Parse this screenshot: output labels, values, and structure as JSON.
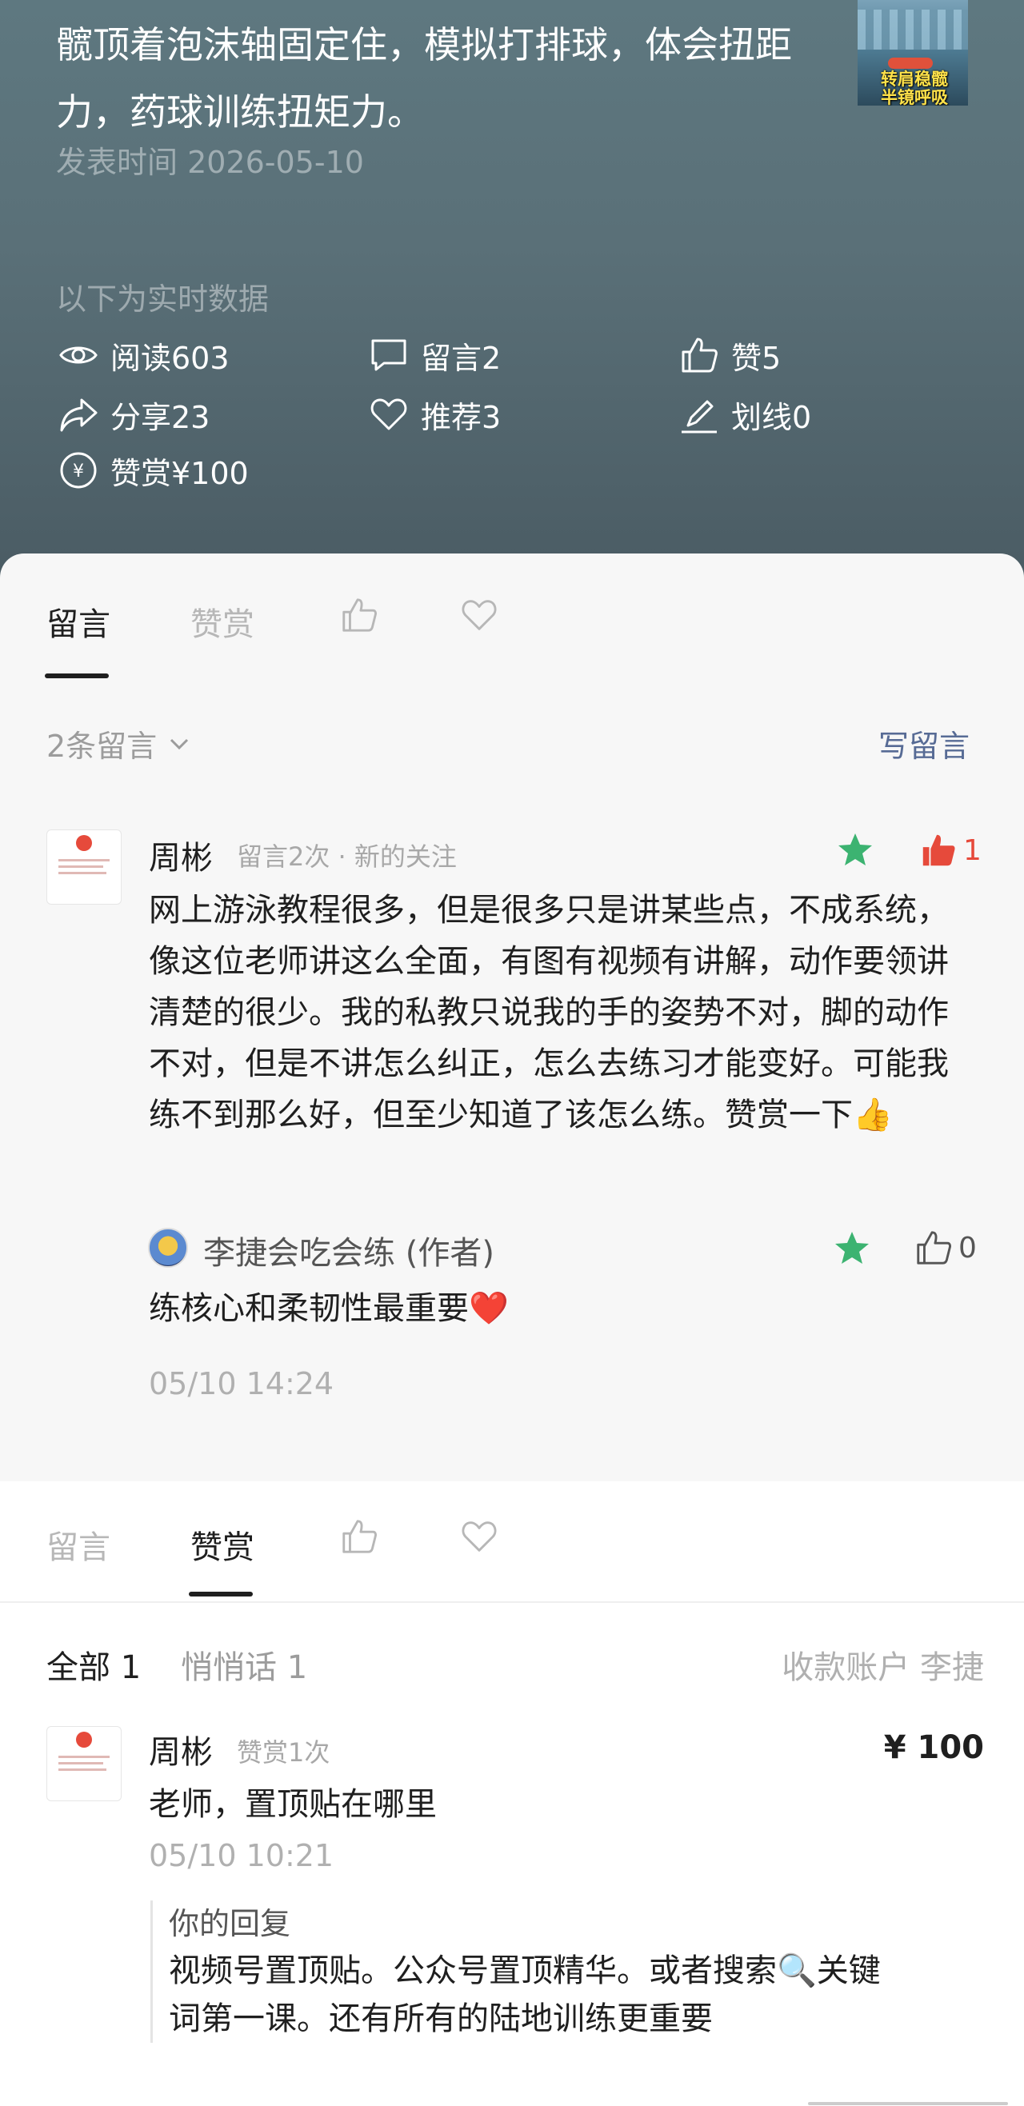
{
  "header": {
    "article_snippet": "髋顶着泡沫轴固定住，模拟打排球，体会扭距力，药球训练扭矩力。",
    "thumbnail_caption_1": "转肩稳髋",
    "thumbnail_caption_2": "半镜呼吸",
    "publish_time": "发表时间 2026-05-10",
    "realtime_label": "以下为实时数据",
    "stats": {
      "read": "阅读603",
      "comments": "留言2",
      "likes": "赞5",
      "shares": "分享23",
      "recommend": "推荐3",
      "underline": "划线0",
      "tips": "赞赏¥100"
    }
  },
  "comments_panel": {
    "tabs": {
      "comments": "留言",
      "rewards": "赞赏"
    },
    "count_label": "2条留言",
    "write_label": "写留言",
    "comment": {
      "author": "周彬",
      "meta": "留言2次 · 新的关注",
      "like_count": "1",
      "body": "网上游泳教程很多，但是很多只是讲某些点，不成系统，像这位老师讲这么全面，有图有视频有讲解，动作要领讲清楚的很少。我的私教只说我的手的姿势不对，脚的动作不对，但是不讲怎么纠正，怎么去练习才能变好。可能我练不到那么好，但至少知道了该怎么练。赞赏一下👍",
      "reply": {
        "author": "李捷会吃会练 (作者)",
        "like_count": "0",
        "body": "练核心和柔韧性最重要❤️"
      },
      "time": "05/10 14:24"
    }
  },
  "rewards_panel": {
    "tabs": {
      "comments": "留言",
      "rewards": "赞赏"
    },
    "filter_all": "全部 1",
    "filter_whisper": "悄悄话 1",
    "account_label": "收款账户 李捷",
    "entry": {
      "author": "周彬",
      "meta": "赞赏1次",
      "amount": "¥ 100",
      "message": "老师，置顶贴在哪里",
      "time": "05/10 10:21",
      "reply_title": "你的回复",
      "reply_body": "视频号置顶贴。公众号置顶精华。或者搜索🔍关键词第一课。还有所有的陆地训练更重要"
    }
  },
  "colors": {
    "header_bg": "#5a7078",
    "link": "#576b95",
    "star": "#3cb371",
    "liked": "#e64a3b"
  }
}
